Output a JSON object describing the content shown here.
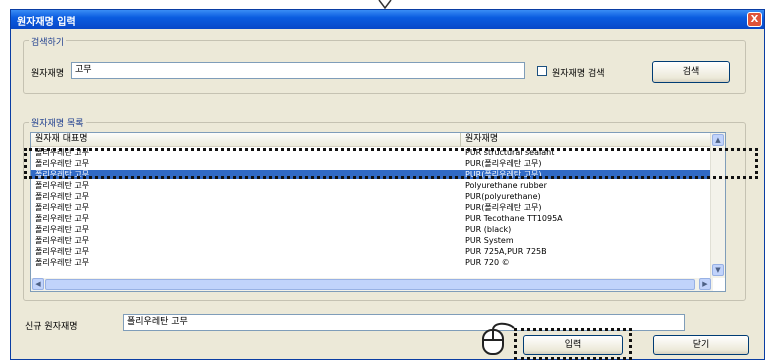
{
  "dialog": {
    "title": "원자재명 입력",
    "close_label": "X"
  },
  "search": {
    "group_label": "검색하기",
    "field_label": "원자재명",
    "value": "고무",
    "checkbox_label": "원자재명 검색",
    "button_label": "검색"
  },
  "list": {
    "group_label": "원자재명 목록",
    "columns": [
      "원자재 대표명",
      "원자재명"
    ],
    "rows": [
      {
        "c1": "폴리우레탄 고무",
        "c2": "PUR structural sealant"
      },
      {
        "c1": "폴리우레탄 고무",
        "c2": "PUR(폴리우레탄 고무)"
      },
      {
        "c1": "폴리우레탄 고무",
        "c2": "PUR(폴리우레탄 고무)"
      },
      {
        "c1": "폴리우레탄 고무",
        "c2": "Polyurethane rubber"
      },
      {
        "c1": "폴리우레탄 고무",
        "c2": "PUR(polyurethane)"
      },
      {
        "c1": "폴리우레탄 고무",
        "c2": "PUR(폴리우레탄 고무)"
      },
      {
        "c1": "폴리우레탄 고무",
        "c2": "PUR Tecothane TT1095A"
      },
      {
        "c1": "폴리우레탄 고무",
        "c2": "PUR (black)"
      },
      {
        "c1": "폴리우레탄 고무",
        "c2": "PUR System"
      },
      {
        "c1": "폴리우레탄 고무",
        "c2": "PUR 725A,PUR 725B"
      },
      {
        "c1": "폴리우레탄 고무",
        "c2": "PUR 720 ©"
      }
    ],
    "selected_index": 2
  },
  "new_material": {
    "field_label": "신규 원자재명",
    "value": "폴리우레탄 고무"
  },
  "buttons": {
    "input_label": "입력",
    "close_label": "닫기"
  }
}
